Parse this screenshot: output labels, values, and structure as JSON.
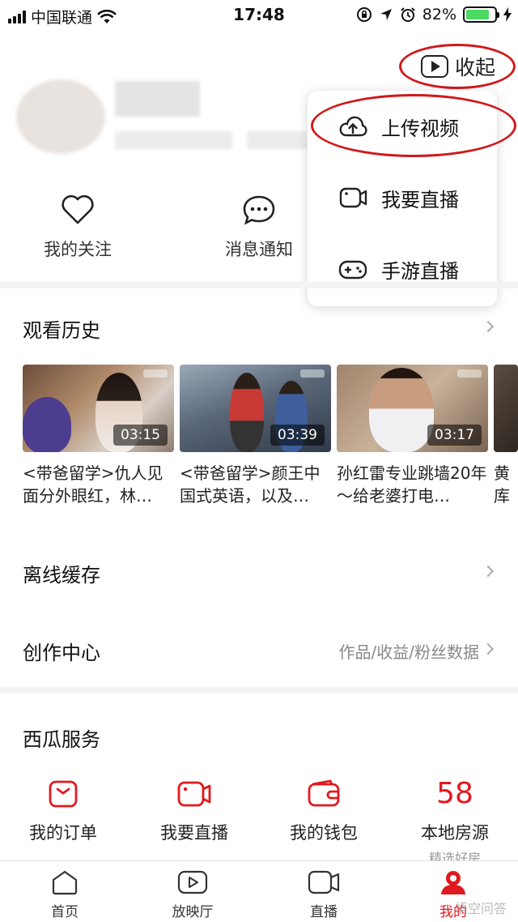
{
  "status_bar": {
    "carrier": "中国联通",
    "time": "17:48",
    "battery_percent": "82%",
    "battery_level": 0.82,
    "icons": [
      "signal-icon",
      "wifi-icon",
      "orientation-lock-icon",
      "location-icon",
      "alarm-icon",
      "battery-icon",
      "charging-icon"
    ]
  },
  "header": {
    "collapse_label": "收起"
  },
  "popup_menu": {
    "items": [
      {
        "label": "上传视频",
        "icon": "upload-cloud-icon"
      },
      {
        "label": "我要直播",
        "icon": "camera-icon"
      },
      {
        "label": "手游直播",
        "icon": "gamepad-icon"
      }
    ]
  },
  "quick_actions": [
    {
      "label": "我的关注",
      "icon": "heart-icon"
    },
    {
      "label": "消息通知",
      "icon": "message-icon"
    }
  ],
  "watch_history": {
    "title": "观看历史",
    "videos": [
      {
        "title": "<带爸留学>仇人见面分外眼红，林…",
        "duration": "03:15"
      },
      {
        "title": "<带爸留学>颜王中国式英语，以及…",
        "duration": "03:39"
      },
      {
        "title": "孙红雷专业跳墙20年～给老婆打电…",
        "duration": "03:17"
      },
      {
        "title": "黄库现场",
        "duration": ""
      }
    ]
  },
  "offline_cache": {
    "title": "离线缓存"
  },
  "creation_center": {
    "title": "创作中心",
    "subtitle": "作品/收益/粉丝数据"
  },
  "services": {
    "title": "西瓜服务",
    "items": [
      {
        "label": "我的订单",
        "icon": "order-icon"
      },
      {
        "label": "我要直播",
        "icon": "live-camera-icon"
      },
      {
        "label": "我的钱包",
        "icon": "wallet-icon"
      },
      {
        "label": "本地房源",
        "icon": "58-icon",
        "icon_text": "58",
        "sub": "精选好房"
      }
    ]
  },
  "tab_bar": {
    "tabs": [
      {
        "label": "首页",
        "icon": "home-icon"
      },
      {
        "label": "放映厅",
        "icon": "play-icon"
      },
      {
        "label": "直播",
        "icon": "camera-icon"
      },
      {
        "label": "我的",
        "icon": "profile-icon",
        "active": true
      }
    ]
  },
  "watermark": "悟空问答",
  "colors": {
    "accent": "#e0191f",
    "annotation_ring": "#d0191c"
  }
}
